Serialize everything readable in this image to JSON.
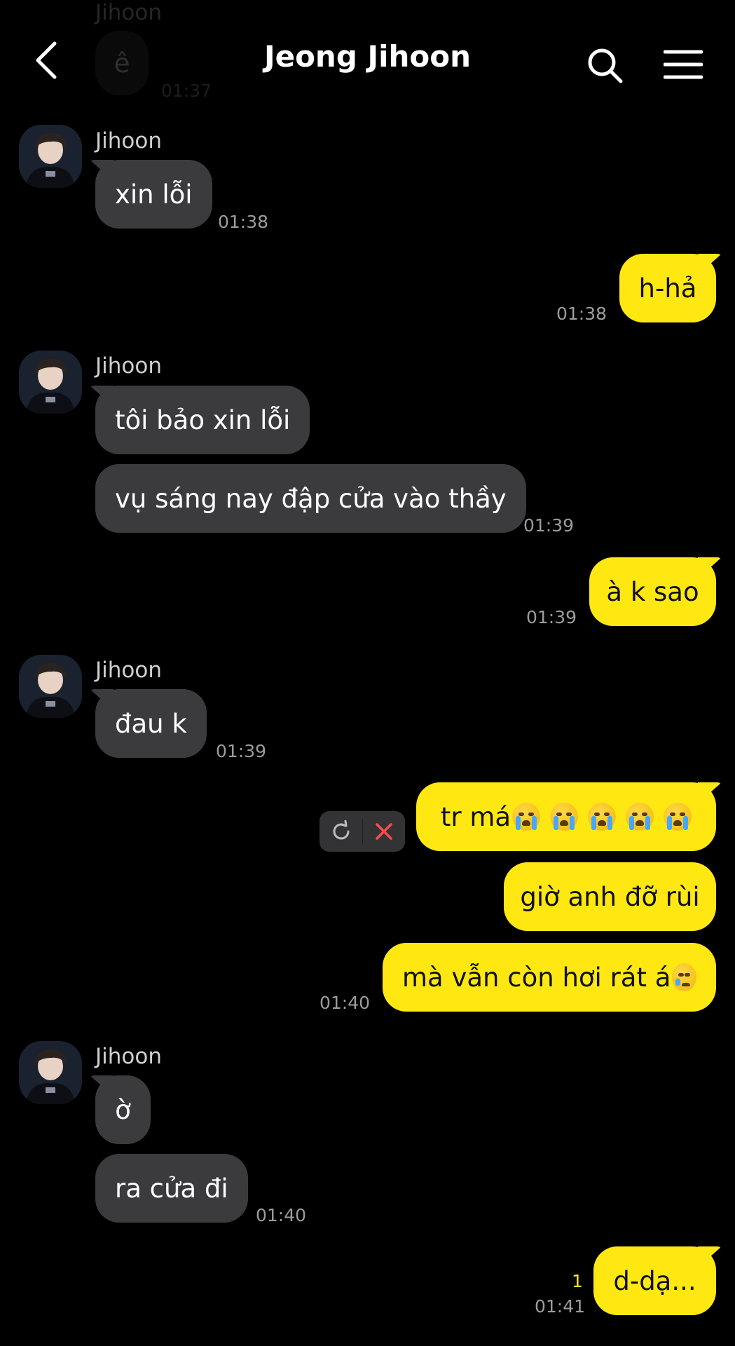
{
  "header": {
    "title": "Jeong Jihoon",
    "back_icon": "chevron-left-icon",
    "search_icon": "search-icon",
    "menu_icon": "hamburger-menu-icon"
  },
  "faded_message": {
    "sender": "Jihoon",
    "text": "ê",
    "time": "01:37"
  },
  "messages": [
    {
      "from": "them",
      "sender": "Jihoon",
      "text": "xin lỗi",
      "time": "01:38"
    },
    {
      "from": "me",
      "text": "h-hả",
      "time": "01:38"
    },
    {
      "from": "them",
      "sender": "Jihoon",
      "text": "tôi bảo xin lỗi"
    },
    {
      "from": "them",
      "text": "vụ sáng nay đập cửa vào thầy",
      "time": "01:39"
    },
    {
      "from": "me",
      "text": "à k sao",
      "time": "01:39"
    },
    {
      "from": "them",
      "sender": "Jihoon",
      "text": "đau k",
      "time": "01:39"
    },
    {
      "from": "me",
      "text": "tr má",
      "emoji": "loudly-crying-face",
      "emoji_count": 5,
      "status": "failed"
    },
    {
      "from": "me",
      "text": "giờ anh đỡ rùi"
    },
    {
      "from": "me",
      "text": "mà vẫn còn hơi rát á",
      "emoji": "face-holding-back-tears",
      "time": "01:40"
    },
    {
      "from": "them",
      "sender": "Jihoon",
      "text": "ờ"
    },
    {
      "from": "them",
      "text": "ra cửa đi",
      "time": "01:40"
    },
    {
      "from": "me",
      "text": "d-dạ...",
      "time": "01:41",
      "unread": "1"
    }
  ],
  "failed_actions": {
    "retry_icon": "retry-icon",
    "delete_icon": "close-icon"
  },
  "colors": {
    "background": "#000000",
    "incoming": "#3b3b3d",
    "outgoing": "#ffe812",
    "unread": "#ffe812"
  }
}
